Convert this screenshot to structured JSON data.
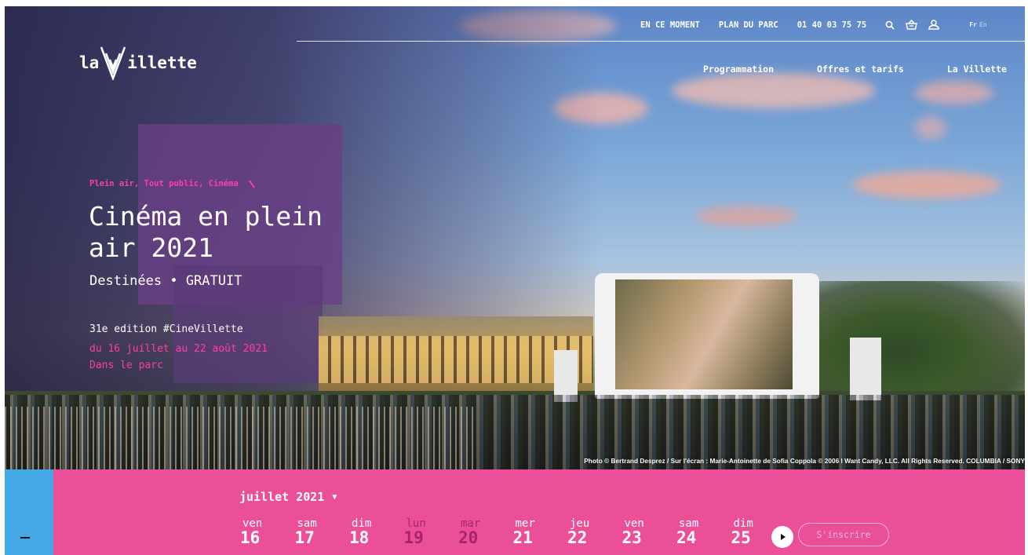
{
  "header": {
    "logo_text_left": "la",
    "logo_text_right": "illette",
    "top_links": [
      "EN CE MOMENT",
      "PLAN DU PARC",
      "01 40 03 75 75"
    ],
    "icons": [
      "search-icon",
      "basket-icon",
      "account-icon"
    ],
    "lang_active": "Fr",
    "lang_other": "En",
    "main_nav": [
      "Programmation",
      "Offres et tarifs",
      "La Villette"
    ]
  },
  "hero": {
    "tags": "Plein air, Tout public, Cinéma",
    "title": "Cinéma en plein air 2021",
    "subtitle": "Destinées • GRATUIT",
    "edition": "31e edition #CineVillette",
    "dates": "du 16 juillet au 22 août 2021",
    "location": "Dans le parc",
    "credit": "Photo © Bertrand Desprez / Sur l'écran : Marie-Antoinette de Sofia Coppola © 2006 I Want Candy, LLC. All Rights Reserved. COLUMBIA / SONY"
  },
  "calendar": {
    "month": "juillet 2021",
    "side_button": "−",
    "days": [
      {
        "name": "ven",
        "num": "16",
        "muted": false
      },
      {
        "name": "sam",
        "num": "17",
        "muted": false
      },
      {
        "name": "dim",
        "num": "18",
        "muted": false
      },
      {
        "name": "lun",
        "num": "19",
        "muted": true
      },
      {
        "name": "mar",
        "num": "20",
        "muted": true
      },
      {
        "name": "mer",
        "num": "21",
        "muted": false
      },
      {
        "name": "jeu",
        "num": "22",
        "muted": false
      },
      {
        "name": "ven",
        "num": "23",
        "muted": false
      },
      {
        "name": "sam",
        "num": "24",
        "muted": false
      },
      {
        "name": "dim",
        "num": "25",
        "muted": false
      }
    ],
    "signup_label": "S'inscrire"
  },
  "colors": {
    "accent_pink": "#eb4f98",
    "tag_pink": "#ff3ea5",
    "side_blue": "#45a8e6"
  }
}
